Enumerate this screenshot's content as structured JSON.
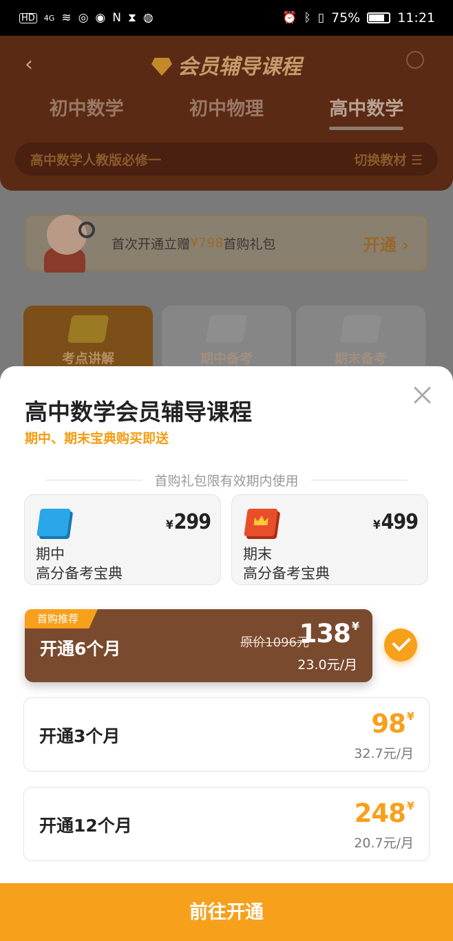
{
  "status_bar": {
    "network": "HD",
    "signal": "4G",
    "battery": "75%",
    "time": "11:21"
  },
  "header": {
    "title": "会员辅导课程",
    "tabs": [
      {
        "label": "初中数学",
        "active": false
      },
      {
        "label": "初中物理",
        "active": false
      },
      {
        "label": "高中数学",
        "active": true
      }
    ],
    "textbook_label": "高中数学人教版必修一",
    "switch_label": "切换教材"
  },
  "promo": {
    "text_before": "首次开通立赠",
    "text_highlight": "¥798",
    "text_after": "首购礼包",
    "action": "开通"
  },
  "categories": [
    {
      "label": "考点讲解",
      "active": true
    },
    {
      "label": "期中备考",
      "active": false
    },
    {
      "label": "期末备考",
      "active": false
    }
  ],
  "sheet": {
    "title": "高中数学会员辅导课程",
    "subtitle": "期中、期末宝典购买即送",
    "divider_text": "首购礼包限有效期内使用",
    "gifts": [
      {
        "currency": "¥",
        "price": "299",
        "line1": "期中",
        "line2": "高分备考宝典",
        "icon": "blue-book-icon"
      },
      {
        "currency": "¥",
        "price": "499",
        "line1": "期末",
        "line2": "高分备考宝典",
        "icon": "red-crown-book-icon"
      }
    ],
    "plans": [
      {
        "badge": "首购推荐",
        "name": "开通6个月",
        "original_price": "原价1096元",
        "price": "138",
        "currency": "¥",
        "per_month": "23.0元/月",
        "selected": true
      },
      {
        "name": "开通3个月",
        "price": "98",
        "currency": "¥",
        "per_month": "32.7元/月",
        "selected": false
      },
      {
        "name": "开通12个月",
        "price": "248",
        "currency": "¥",
        "per_month": "20.7元/月",
        "selected": false
      }
    ],
    "cta": "前往开通"
  },
  "colors": {
    "accent": "#f7a01c",
    "featured_plan": "#7a4a2e",
    "subtitle": "#f39c12"
  }
}
